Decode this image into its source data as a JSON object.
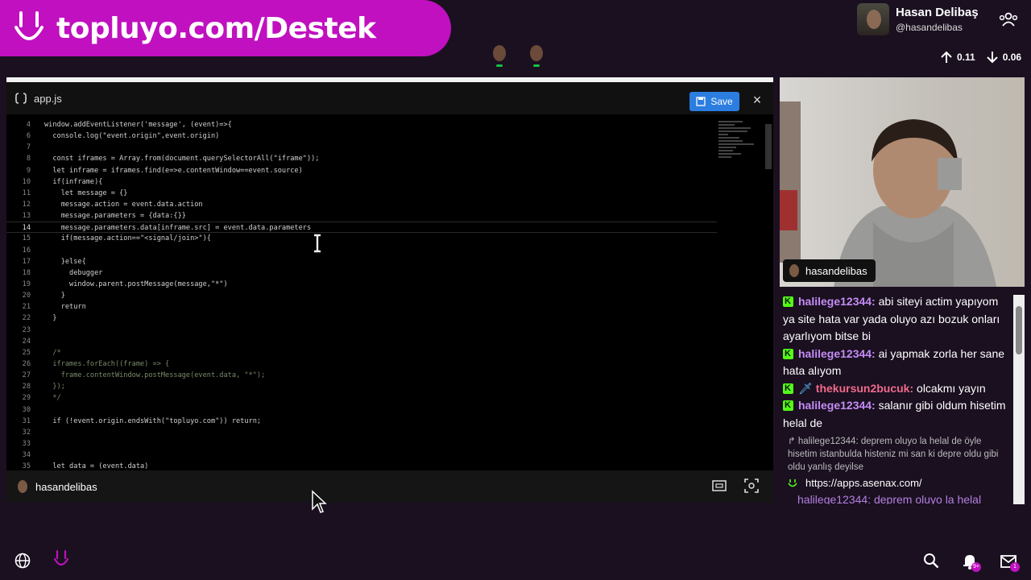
{
  "banner": {
    "text": "topluyo.com/Destek"
  },
  "profile": {
    "name": "Hasan Delibaş",
    "handle": "@hasandelibas"
  },
  "stats": {
    "up": "0.11",
    "down": "0.06"
  },
  "editor": {
    "filename": "app.js",
    "save_label": "Save",
    "close_label": "×",
    "footer_user": "hasandelibas",
    "lines": [
      {
        "n": "4",
        "t": "window.addEventListener('message', (event)=>{"
      },
      {
        "n": "6",
        "t": "  console.log(\"event.origin\",event.origin)"
      },
      {
        "n": "7",
        "t": ""
      },
      {
        "n": "8",
        "t": "  const iframes = Array.from(document.querySelectorAll(\"iframe\"));"
      },
      {
        "n": "9",
        "t": "  let inframe = iframes.find(e=>e.contentWindow==event.source)"
      },
      {
        "n": "10",
        "t": "  if(inframe){"
      },
      {
        "n": "11",
        "t": "    let message = {}"
      },
      {
        "n": "12",
        "t": "    message.action = event.data.action"
      },
      {
        "n": "13",
        "t": "    message.parameters = {data:{}}"
      },
      {
        "n": "14",
        "t": "    message.parameters.data[inframe.src] = event.data.parameters"
      },
      {
        "n": "15",
        "t": "    if(message.action==\"<signal/join>\"){"
      },
      {
        "n": "16",
        "t": ""
      },
      {
        "n": "17",
        "t": "    }else{"
      },
      {
        "n": "18",
        "t": "      debugger"
      },
      {
        "n": "19",
        "t": "      window.parent.postMessage(message,\"*\")"
      },
      {
        "n": "20",
        "t": "    }"
      },
      {
        "n": "21",
        "t": "    return"
      },
      {
        "n": "22",
        "t": "  }"
      },
      {
        "n": "23",
        "t": ""
      },
      {
        "n": "24",
        "t": ""
      },
      {
        "n": "25",
        "t": "  /*"
      },
      {
        "n": "26",
        "t": "  iframes.forEach((frame) => {"
      },
      {
        "n": "27",
        "t": "    frame.contentWindow.postMessage(event.data, \"*\");"
      },
      {
        "n": "28",
        "t": "  });"
      },
      {
        "n": "29",
        "t": "  */"
      },
      {
        "n": "30",
        "t": ""
      },
      {
        "n": "31",
        "t": "  if (!event.origin.endsWith(\"topluyo.com\")) return;"
      },
      {
        "n": "32",
        "t": ""
      },
      {
        "n": "33",
        "t": ""
      },
      {
        "n": "34",
        "t": ""
      },
      {
        "n": "35",
        "t": "  let data = (event.data)"
      }
    ]
  },
  "webcam": {
    "label": "hasandelibas"
  },
  "chat": {
    "messages": [
      {
        "user": "halilege12344:",
        "text": "abi siteyi actim yapıyom ya site hata var yada oluyo azı bozuk onları ayarlıyom bitse bi"
      },
      {
        "user": "halilege12344:",
        "text": "ai yapmak zorla her sane hata alıyom"
      },
      {
        "user": "thekursun2bucuk:",
        "text": "olcakmı yayın"
      },
      {
        "user": "halilege12344:",
        "text": "salanır gibi oldum hisetim helal de"
      }
    ],
    "reply": "↱ halilege12344: deprem oluyo la helal de öyle hisetim istanbulda histeniz mi san ki depre oldu gibi oldu yanlış deyilse",
    "link": "https://apps.asenax.com/",
    "cut_line": "halilege12344: deprem oluyo la helal"
  },
  "bottom": {
    "bell_badge": "9+",
    "mail_badge": "1"
  }
}
